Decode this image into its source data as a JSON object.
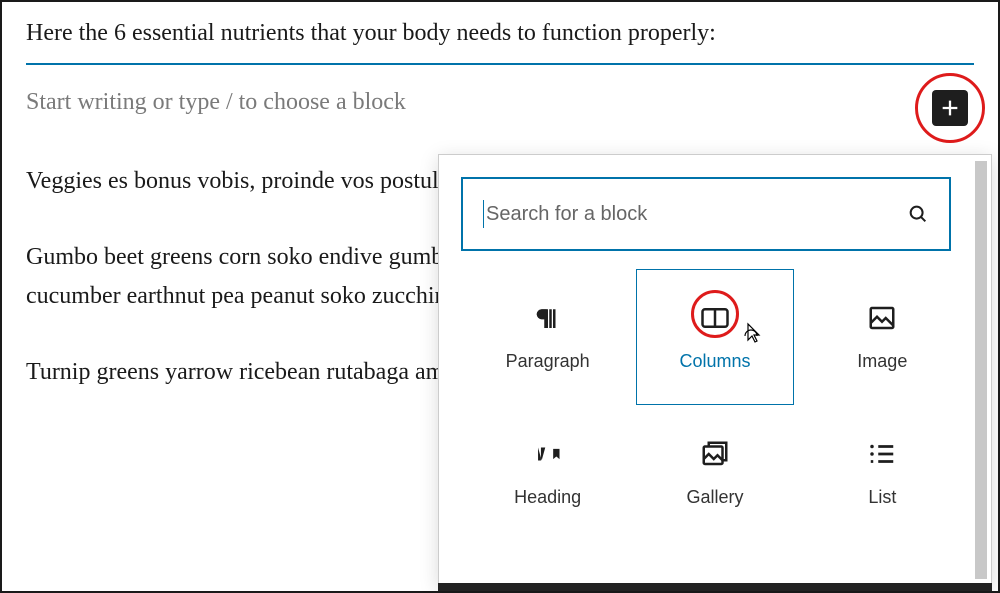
{
  "heading": "Here the 6 essential nutrients that your body needs to function properly:",
  "placeholder_text": "Start writing or type / to choose a block",
  "paragraphs": {
    "p1": "Veggies es bonus vobis, proinde vos postulant daikon amaranth tatsoi tomatillo melon",
    "p2": "Gumbo beet greens corn soko endive gumbo pea sprouts fava bean collard greens dandelion cucumber earthnut pea peanut soko zucchini.",
    "p3": "Turnip greens yarrow ricebean rutabaga amaranth water spinach avocado daikon"
  },
  "search": {
    "placeholder": "Search for a block",
    "value": ""
  },
  "blocks": {
    "paragraph": "Paragraph",
    "columns": "Columns",
    "image": "Image",
    "heading": "Heading",
    "gallery": "Gallery",
    "list": "List"
  },
  "selected_block": "columns"
}
